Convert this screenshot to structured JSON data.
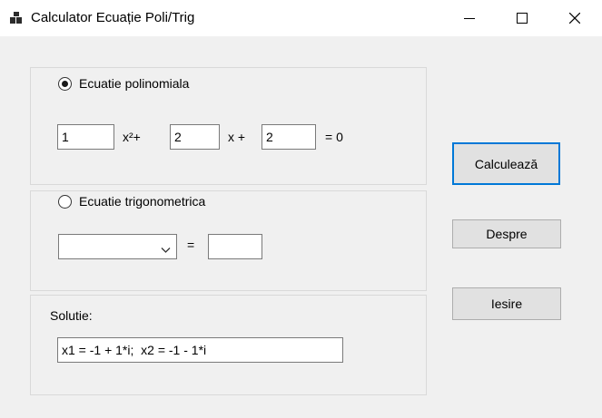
{
  "window": {
    "title": "Calculator Ecuație Poli/Trig"
  },
  "poly": {
    "radio_label": "Ecuatie polinomiala",
    "selected": true,
    "a": "1",
    "term1": "x²+",
    "b": "2",
    "term2": "x +",
    "c": "2",
    "equals_zero": "= 0"
  },
  "trig": {
    "radio_label": "Ecuatie trigonometrica",
    "selected": false,
    "function_selected": "",
    "equals": "=",
    "value": ""
  },
  "solution": {
    "label": "Solutie:",
    "value": "x1 = -1 + 1*i;  x2 = -1 - 1*i"
  },
  "buttons": {
    "calculate": "Calculează",
    "about": "Despre",
    "exit": "Iesire"
  }
}
